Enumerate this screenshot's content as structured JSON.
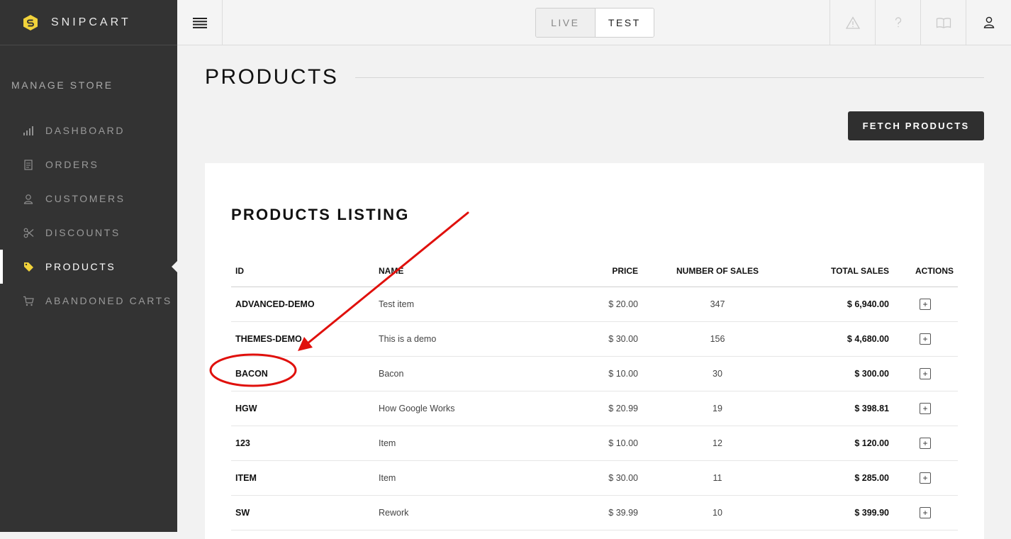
{
  "brand": {
    "name": "SNIPCART"
  },
  "sidebar": {
    "section_title": "MANAGE STORE",
    "items": [
      {
        "label": "DASHBOARD",
        "icon": "bar-chart-icon"
      },
      {
        "label": "ORDERS",
        "icon": "receipt-icon"
      },
      {
        "label": "CUSTOMERS",
        "icon": "user-icon"
      },
      {
        "label": "DISCOUNTS",
        "icon": "scissors-icon"
      },
      {
        "label": "PRODUCTS",
        "icon": "tag-icon",
        "active": true
      },
      {
        "label": "ABANDONED CARTS",
        "icon": "cart-icon"
      }
    ]
  },
  "topbar": {
    "mode": {
      "live_label": "LIVE",
      "test_label": "TEST",
      "selected": "TEST"
    },
    "icons": [
      "warning-icon",
      "help-icon",
      "book-icon",
      "account-icon"
    ]
  },
  "main": {
    "page_title": "PRODUCTS",
    "fetch_button": "FETCH PRODUCTS",
    "listing_title": "PRODUCTS LISTING",
    "columns": [
      "ID",
      "NAME",
      "PRICE",
      "NUMBER OF SALES",
      "TOTAL SALES",
      "ACTIONS"
    ],
    "rows": [
      {
        "id": "ADVANCED-DEMO",
        "name": "Test item",
        "price": "$ 20.00",
        "sales": "347",
        "total": "$ 6,940.00"
      },
      {
        "id": "THEMES-DEMO",
        "name": "This is a demo",
        "price": "$ 30.00",
        "sales": "156",
        "total": "$ 4,680.00"
      },
      {
        "id": "BACON",
        "name": "Bacon",
        "price": "$ 10.00",
        "sales": "30",
        "total": "$ 300.00"
      },
      {
        "id": "HGW",
        "name": "How Google Works",
        "price": "$ 20.99",
        "sales": "19",
        "total": "$ 398.81"
      },
      {
        "id": "123",
        "name": "Item",
        "price": "$ 10.00",
        "sales": "12",
        "total": "$ 120.00"
      },
      {
        "id": "ITEM",
        "name": "Item",
        "price": "$ 30.00",
        "sales": "11",
        "total": "$ 285.00"
      },
      {
        "id": "SW",
        "name": "Rework",
        "price": "$ 39.99",
        "sales": "10",
        "total": "$ 399.90"
      }
    ],
    "action_symbol": "+"
  },
  "colors": {
    "sidebar_bg": "#333333",
    "logo_yellow": "#f2d33b",
    "annotation_red": "#e0100c",
    "button_dark": "#2f2f2f"
  }
}
